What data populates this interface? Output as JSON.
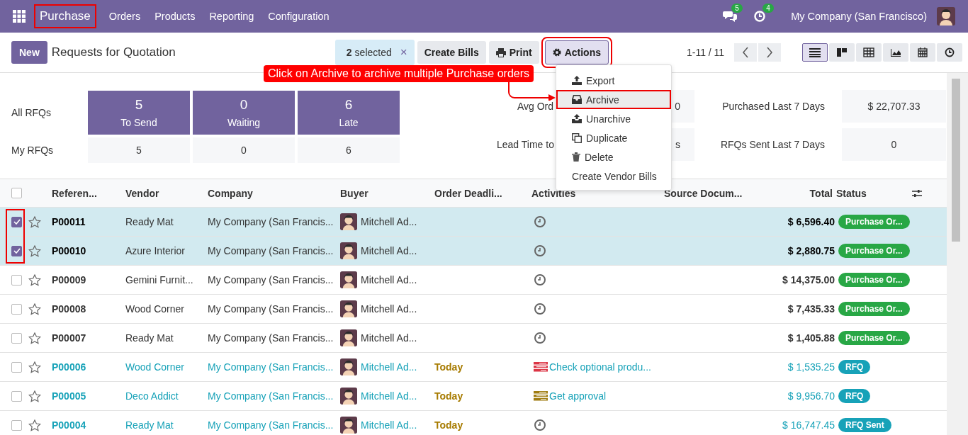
{
  "navbar": {
    "app": "Purchase",
    "app_highlighted": true,
    "menu": [
      "Orders",
      "Products",
      "Reporting",
      "Configuration"
    ],
    "messages_count": "5",
    "activities_count": "4",
    "company": "My Company (San Francisco)"
  },
  "control_panel": {
    "new_button": "New",
    "title": "Requests for Quotation",
    "selected_count": "2",
    "selected_label": "selected",
    "clear": "×",
    "buttons": [
      {
        "label": "Create Bills",
        "kind": "plain",
        "highlighted": false
      },
      {
        "label": "Print",
        "kind": "print",
        "highlighted": false
      },
      {
        "label": "Actions",
        "kind": "gear",
        "highlighted": true
      }
    ],
    "pager": "1-11 / 11",
    "views": [
      {
        "kind": "list",
        "selected": true
      },
      {
        "kind": "kanban",
        "selected": false
      },
      {
        "kind": "pivot",
        "selected": false
      },
      {
        "kind": "graph",
        "selected": false
      },
      {
        "kind": "calendar",
        "selected": false
      },
      {
        "kind": "activity",
        "selected": false
      }
    ]
  },
  "actions_menu": [
    {
      "label": "Export",
      "kind": "export",
      "highlighted": false
    },
    {
      "label": "Archive",
      "kind": "archive",
      "highlighted": true
    },
    {
      "label": "Unarchive",
      "kind": "unarchive",
      "highlighted": false
    },
    {
      "label": "Duplicate",
      "kind": "duplicate",
      "highlighted": false
    },
    {
      "label": "Delete",
      "kind": "delete",
      "highlighted": false
    },
    {
      "label": "Create Vendor Bills",
      "kind": "plain",
      "highlighted": false
    }
  ],
  "annotation": {
    "text": "Click on Archive to archive multiple Purchase orders"
  },
  "dashboard": {
    "row_labels": [
      "All RFQs",
      "My RFQs"
    ],
    "tiles": [
      {
        "count": "5",
        "label": "To Send",
        "mine": "5"
      },
      {
        "count": "0",
        "label": "Waiting",
        "mine": "0"
      },
      {
        "count": "6",
        "label": "Late",
        "mine": "6"
      }
    ],
    "stats": [
      {
        "label": "Avg Ord",
        "value": "0"
      },
      {
        "label": "Purchased Last 7 Days",
        "value": "$ 22,707.33"
      },
      {
        "label": "Lead Time to",
        "value": "s"
      },
      {
        "label": "RFQs Sent Last 7 Days",
        "value": "0"
      }
    ]
  },
  "table": {
    "selection_highlighted": true,
    "all_selected": false,
    "columns": [
      "Referen...",
      "Vendor",
      "Company",
      "Buyer",
      "Order Deadli...",
      "Activities",
      "Source Docum...",
      "Total",
      "Status"
    ],
    "rows": [
      {
        "selected": true,
        "draft": false,
        "reference": "P00011",
        "vendor": "Ready Mat",
        "company": "My Company (San Francis...",
        "buyer": "Mitchell Ad...",
        "deadline": "",
        "activity": {
          "kind": "clock"
        },
        "total": "$ 6,596.40",
        "status": {
          "label": "Purchase Or...",
          "kind": "purchase"
        }
      },
      {
        "selected": true,
        "draft": false,
        "reference": "P00010",
        "vendor": "Azure Interior",
        "company": "My Company (San Francis...",
        "buyer": "Mitchell Ad...",
        "deadline": "",
        "activity": {
          "kind": "clock"
        },
        "total": "$ 2,880.75",
        "status": {
          "label": "Purchase Or...",
          "kind": "purchase"
        }
      },
      {
        "selected": false,
        "draft": false,
        "reference": "P00009",
        "vendor": "Gemini Furnit...",
        "company": "My Company (San Francis...",
        "buyer": "Mitchell Ad...",
        "deadline": "",
        "activity": {
          "kind": "clock"
        },
        "total": "$ 14,375.00",
        "status": {
          "label": "Purchase Or...",
          "kind": "purchase"
        }
      },
      {
        "selected": false,
        "draft": false,
        "reference": "P00008",
        "vendor": "Wood Corner",
        "company": "My Company (San Francis...",
        "buyer": "Mitchell Ad...",
        "deadline": "",
        "activity": {
          "kind": "clock"
        },
        "total": "$ 7,435.33",
        "status": {
          "label": "Purchase Or...",
          "kind": "purchase"
        }
      },
      {
        "selected": false,
        "draft": false,
        "reference": "P00007",
        "vendor": "Ready Mat",
        "company": "My Company (San Francis...",
        "buyer": "Mitchell Ad...",
        "deadline": "",
        "activity": {
          "kind": "clock"
        },
        "total": "$ 1,405.88",
        "status": {
          "label": "Purchase Or...",
          "kind": "purchase"
        }
      },
      {
        "selected": false,
        "draft": true,
        "reference": "P00006",
        "vendor": "Wood Corner",
        "company": "My Company (San Francis...",
        "buyer": "Mitchell Ad...",
        "deadline": "Today",
        "activity": {
          "kind": "todo",
          "color": "#dc3545",
          "text": "Check optional produ..."
        },
        "total": "$ 1,535.25",
        "status": {
          "label": "RFQ",
          "kind": "rfq"
        }
      },
      {
        "selected": false,
        "draft": true,
        "reference": "P00005",
        "vendor": "Deco Addict",
        "company": "My Company (San Francis...",
        "buyer": "Mitchell Ad...",
        "deadline": "Today",
        "activity": {
          "kind": "todo",
          "color": "#a07d12",
          "text": "Get approval"
        },
        "total": "$ 9,956.70",
        "status": {
          "label": "RFQ",
          "kind": "rfq"
        }
      },
      {
        "selected": false,
        "draft": true,
        "reference": "P00004",
        "vendor": "Ready Mat",
        "company": "My Company (San Francis...",
        "buyer": "Mitchell Ad...",
        "deadline": "Today",
        "activity": {
          "kind": "clock"
        },
        "total": "$ 16,747.45",
        "status": {
          "label": "RFQ Sent",
          "kind": "rfq"
        }
      }
    ]
  }
}
